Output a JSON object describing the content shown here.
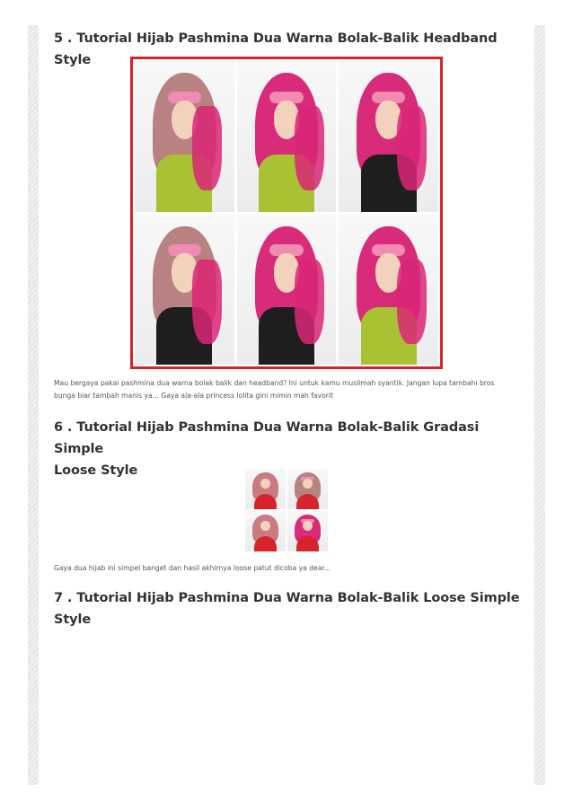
{
  "sections": [
    {
      "heading": "5 . Tutorial Hijab Pashmina Dua Warna Bolak-Balik Headband Style",
      "caption_lines": [
        "Mau bergaya pakai pashmina dua warna bolak balik dan headband? Ini untuk kamu muslimah syantik. Jangan lupa tambahi bros",
        "bunga biar tambah manis ya... Gaya ala-ala princess lolita gini mimin mah favorit"
      ]
    },
    {
      "heading_lines": [
        "6 . Tutorial Hijab Pashmina Dua Warna Bolak-Balik Gradasi Simple",
        "Loose Style"
      ],
      "caption": "Gaya dua hijab ini simpel banget dan hasil akhirnya loose patut dicoba ya dear..."
    },
    {
      "heading_lines": [
        "7 . Tutorial Hijab Pashmina Dua Warna Bolak-Balik Loose Simple",
        "Style"
      ]
    }
  ],
  "colors": {
    "heading": "#333333",
    "caption": "#555555",
    "image_border": "#d7232b",
    "accent_pink": "#d82b79"
  }
}
